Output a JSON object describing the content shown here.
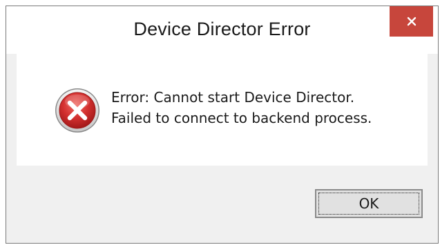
{
  "window": {
    "title": "Device Director Error"
  },
  "close_button": {
    "icon": "close-icon"
  },
  "message": {
    "line1": "Error: Cannot start Device Director.",
    "line2": "Failed to connect to backend process.",
    "icon": "error-icon"
  },
  "buttons": {
    "ok_label": "OK"
  },
  "colors": {
    "close_button_bg": "#c7463c",
    "error_icon_red": "#c9272b",
    "dialog_bg": "#f0f0f0"
  }
}
